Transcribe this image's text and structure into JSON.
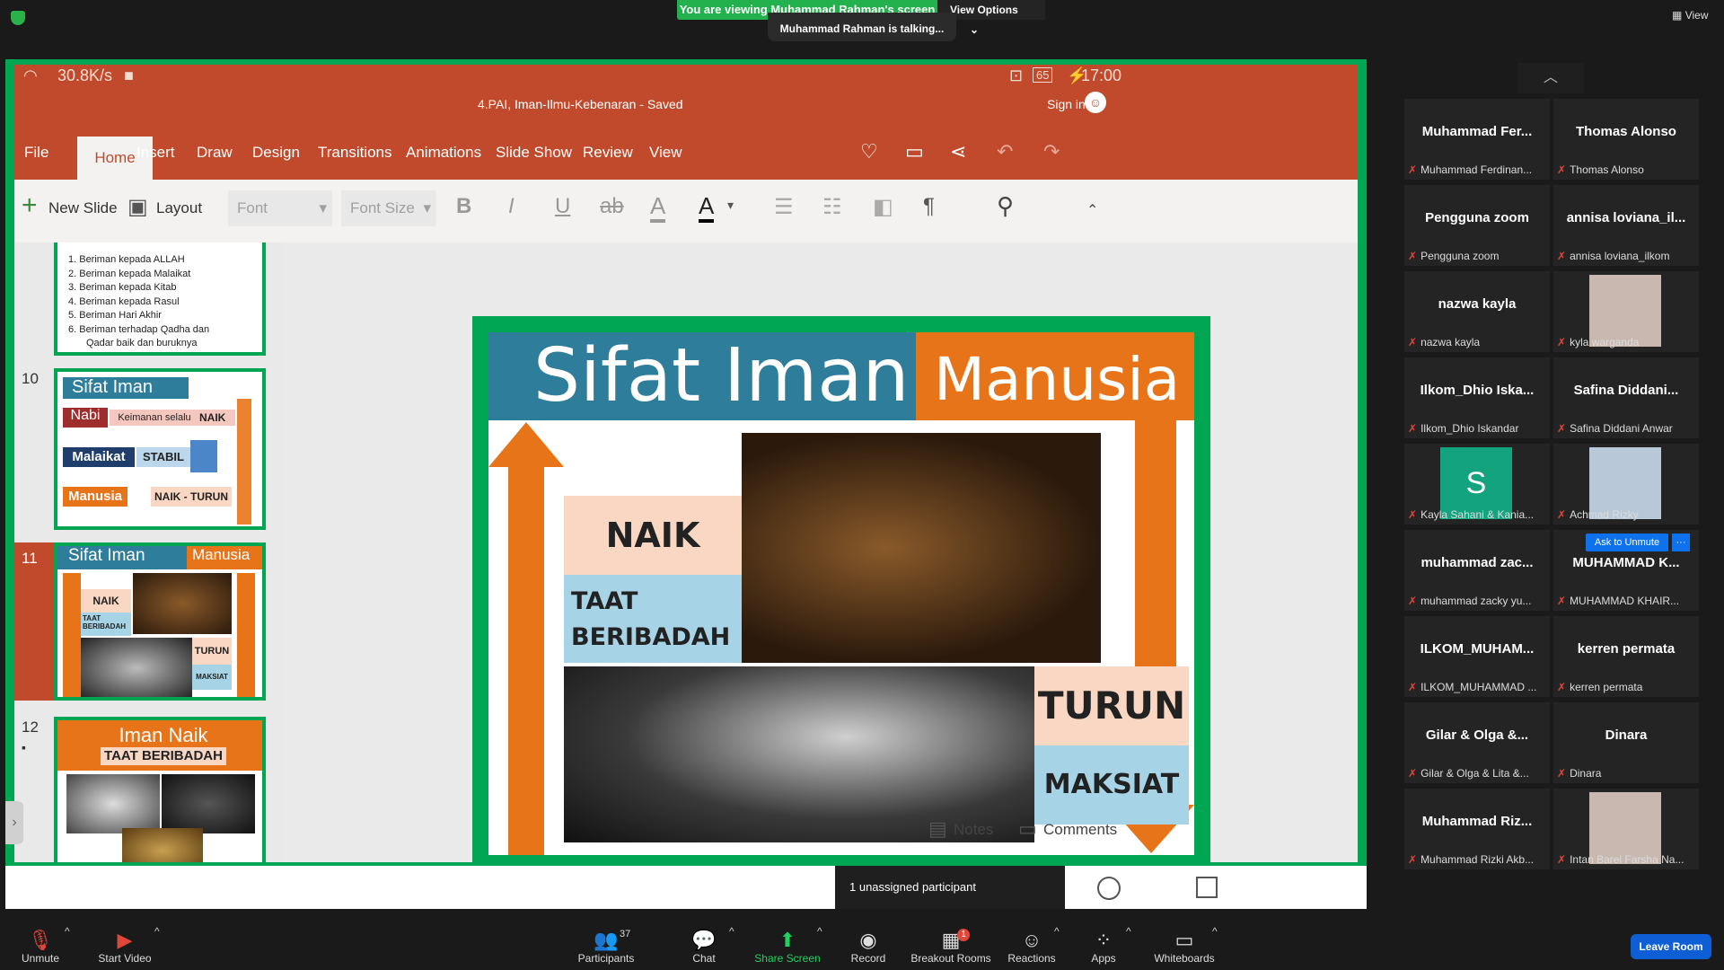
{
  "zoom_top": {
    "viewing_banner": "You are viewing Muhammad Rahman's screen",
    "view_options": "View Options",
    "talking": "Muhammad Rahman is talking...",
    "view_label": "View"
  },
  "phone_status": {
    "net_speed": "30.8K/s",
    "battery": "65",
    "time": "17:00"
  },
  "ppt": {
    "doc_title": "4.PAI, Iman-Ilmu-Kebenaran - Saved",
    "sign_in": "Sign in",
    "tabs": [
      "File",
      "Home",
      "Insert",
      "Draw",
      "Design",
      "Transitions",
      "Animations",
      "Slide Show",
      "Review",
      "View"
    ],
    "new_slide": "New Slide",
    "layout": "Layout",
    "font_placeholder": "Font",
    "font_size_placeholder": "Font Size",
    "notes": "Notes",
    "comments": "Comments"
  },
  "thumbs": {
    "list_items": [
      "1.  Beriman kepada ALLAH",
      "2.  Beriman kepada Malaikat",
      "3.  Beriman kepada Kitab",
      "4.  Beriman kepada Rasul",
      "5.  Beriman Hari Akhir",
      "6.  Beriman terhadap Qadha dan",
      "Qadar baik dan buruknya"
    ],
    "s10": {
      "num": "10",
      "title": "Sifat Iman",
      "nabi": "Nabi",
      "nabi_text": "Keimanan selalu",
      "naik": "NAIK",
      "malaikat": "Malaikat",
      "stabil": "STABIL",
      "manusia": "Manusia",
      "naik_turun": "NAIK - TURUN"
    },
    "s11": {
      "num": "11",
      "title": "Sifat Iman",
      "title2": "Manusia",
      "naik": "NAIK",
      "taat": "TAAT",
      "beribadah": "BERIBADAH",
      "turun": "TURUN",
      "maksiat": "MAKSIAT"
    },
    "s12": {
      "num": "12",
      "title": "Iman Naik",
      "sub": "TAAT BERIBADAH"
    }
  },
  "slide": {
    "title_left": "Sifat Iman",
    "title_right": "Manusia",
    "naik": "NAIK",
    "taat": "TAAT",
    "beribadah": "BERIBADAH",
    "turun": "TURUN",
    "maksiat": "MAKSIAT"
  },
  "unassigned": "1 unassigned participant",
  "participants": [
    {
      "name": "Muhammad  Fer...",
      "sub": "Muhammad Ferdinan..."
    },
    {
      "name": "Thomas Alonso",
      "sub": "Thomas Alonso"
    },
    {
      "name": "Pengguna zoom",
      "sub": "Pengguna zoom"
    },
    {
      "name": "annisa  loviana_il...",
      "sub": "annisa loviana_ilkom"
    },
    {
      "name": "nazwa kayla",
      "sub": "nazwa kayla"
    },
    {
      "name": "",
      "sub": "kyla warganda"
    },
    {
      "name": "Ilkom_Dhio  Iska...",
      "sub": "Ilkom_Dhio Iskandar"
    },
    {
      "name": "Safina  Diddani...",
      "sub": "Safina Diddani Anwar"
    },
    {
      "name": "",
      "sub": "Kayla Sahani & Kania..."
    },
    {
      "name": "",
      "sub": "Achmad Rizky"
    },
    {
      "name": "muhammad  zac...",
      "sub": "muhammad zacky yu..."
    },
    {
      "name": "MUHAMMAD  K...",
      "sub": "MUHAMMAD KHAIR..."
    },
    {
      "name": "ILKOM_MUHAM...",
      "sub": "ILKOM_MUHAMMAD ..."
    },
    {
      "name": "kerren permata",
      "sub": "kerren permata"
    },
    {
      "name": "Gilar & Olga &...",
      "sub": "Gilar & Olga & Lita &..."
    },
    {
      "name": "Dinara",
      "sub": "Dinara"
    },
    {
      "name": "Muhammad  Riz...",
      "sub": "Muhammad Rizki Akb..."
    },
    {
      "name": "",
      "sub": "Intan Barel Farsha Na..."
    }
  ],
  "avatar_letter": "S",
  "ask_to_unmute": "Ask to Unmute",
  "bottom": {
    "unmute": "Unmute",
    "start_video": "Start Video",
    "participants": "Participants",
    "participants_count": "37",
    "chat": "Chat",
    "share_screen": "Share Screen",
    "record": "Record",
    "breakout": "Breakout Rooms",
    "breakout_badge": "1",
    "reactions": "Reactions",
    "apps": "Apps",
    "whiteboards": "Whiteboards",
    "leave": "Leave Room"
  },
  "colors": {
    "zoom_green": "#23b14d",
    "ppt_red": "#c04a2b",
    "slide_green": "#00a651",
    "leave_blue": "#0e5fd6"
  }
}
